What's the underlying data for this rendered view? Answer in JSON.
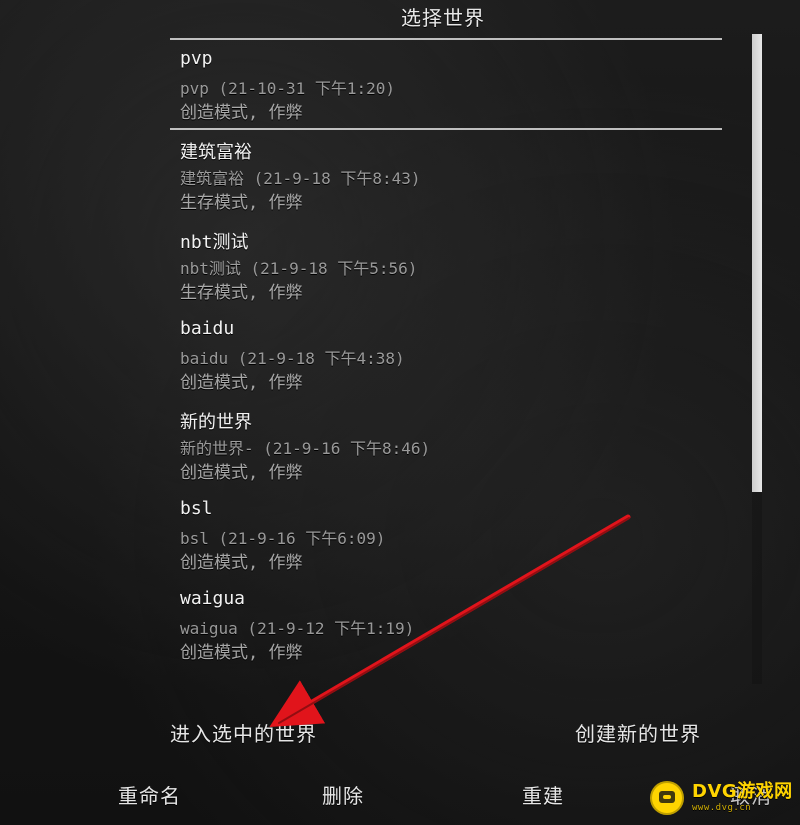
{
  "screen": {
    "title": "选择世界"
  },
  "worlds": [
    {
      "name": "pvp",
      "meta": "pvp (21-10-31 下午1:20)",
      "mode": "创造模式, 作弊",
      "selected": true
    },
    {
      "name": "建筑富裕",
      "meta": "建筑富裕 (21-9-18 下午8:43)",
      "mode": "生存模式, 作弊",
      "selected": false
    },
    {
      "name": "nbt测试",
      "meta": "nbt测试 (21-9-18 下午5:56)",
      "mode": "生存模式, 作弊",
      "selected": false
    },
    {
      "name": "baidu",
      "meta": "baidu (21-9-18 下午4:38)",
      "mode": "创造模式, 作弊",
      "selected": false
    },
    {
      "name": "新的世界",
      "meta": "新的世界- (21-9-16 下午8:46)",
      "mode": "创造模式, 作弊",
      "selected": false
    },
    {
      "name": "bsl",
      "meta": "bsl (21-9-16 下午6:09)",
      "mode": "创造模式, 作弊",
      "selected": false
    },
    {
      "name": "waigua",
      "meta": "waigua (21-9-12 下午1:19)",
      "mode": "创造模式, 作弊",
      "selected": false
    }
  ],
  "buttons": {
    "enter_selected": "进入选中的世界",
    "create_new": "创建新的世界",
    "rename": "重命名",
    "delete": "删除",
    "rebuild": "重建",
    "cancel": "取消"
  },
  "watermark": {
    "main": "DVG游戏网",
    "sub": "www.dvg.cn"
  },
  "colors": {
    "annotation_red": "#e1141b",
    "watermark_yellow": "#ffd400"
  },
  "scrollbar": {
    "position_fraction": 0.0,
    "visible_fraction": 0.7
  }
}
